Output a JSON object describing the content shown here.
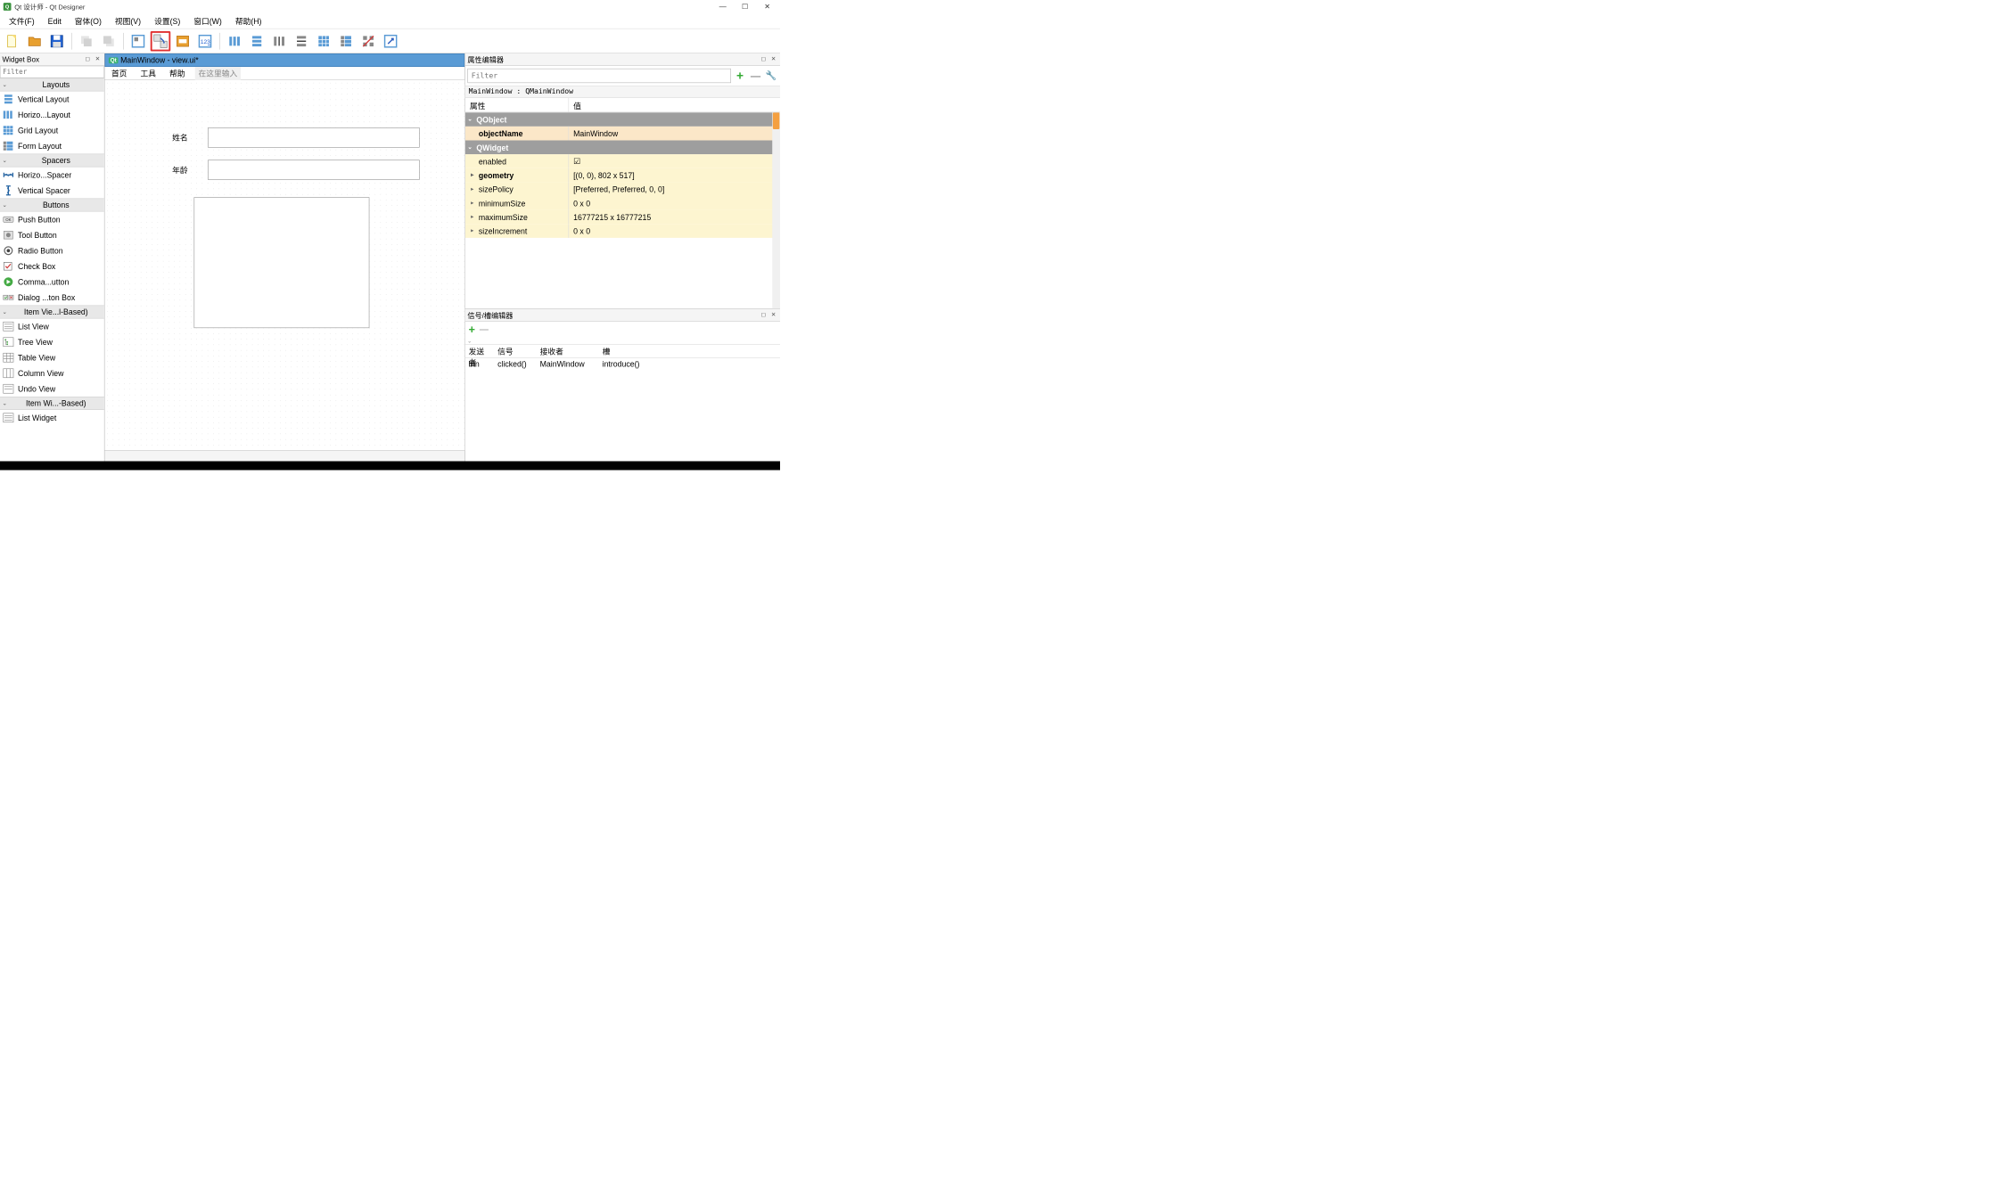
{
  "title": "Qt 设计师 - Qt Designer",
  "menubar": [
    "文件(F)",
    "Edit",
    "窗体(O)",
    "视图(V)",
    "设置(S)",
    "窗口(W)",
    "帮助(H)"
  ],
  "widgetbox": {
    "title": "Widget Box",
    "filter_placeholder": "Filter",
    "categories": [
      {
        "name": "Layouts",
        "items": [
          "Vertical Layout",
          "Horizo...Layout",
          "Grid Layout",
          "Form Layout"
        ]
      },
      {
        "name": "Spacers",
        "items": [
          "Horizo...Spacer",
          "Vertical Spacer"
        ]
      },
      {
        "name": "Buttons",
        "items": [
          "Push Button",
          "Tool Button",
          "Radio Button",
          "Check Box",
          "Comma...utton",
          "Dialog ...ton Box"
        ]
      },
      {
        "name": "Item Vie...l-Based)",
        "items": [
          "List View",
          "Tree View",
          "Table View",
          "Column View",
          "Undo View"
        ]
      },
      {
        "name": "Item Wi...-Based)",
        "items": [
          "List Widget"
        ]
      }
    ]
  },
  "form": {
    "title": "MainWindow - view.ui*",
    "menubar": [
      "首页",
      "工具",
      "帮助"
    ],
    "menubar_placeholder": "在这里输入",
    "labels": {
      "name": "姓名",
      "age": "年龄"
    }
  },
  "property_editor": {
    "title": "属性编辑器",
    "filter_placeholder": "Filter",
    "object_text": "MainWindow : QMainWindow",
    "col_prop": "属性",
    "col_val": "值",
    "groups": [
      {
        "name": "QObject",
        "rows": [
          {
            "prop": "objectName",
            "val": "MainWindow",
            "cls": "orange bold"
          }
        ]
      },
      {
        "name": "QWidget",
        "rows": [
          {
            "prop": "enabled",
            "val": "☑",
            "cls": "yellow"
          },
          {
            "prop": "geometry",
            "val": "[(0, 0), 802 x 517]",
            "cls": "yellow bold",
            "expandable": true
          },
          {
            "prop": "sizePolicy",
            "val": "[Preferred, Preferred, 0, 0]",
            "cls": "yellow",
            "expandable": true
          },
          {
            "prop": "minimumSize",
            "val": "0 x 0",
            "cls": "yellow",
            "expandable": true
          },
          {
            "prop": "maximumSize",
            "val": "16777215 x 16777215",
            "cls": "yellow",
            "expandable": true
          },
          {
            "prop": "sizeIncrement",
            "val": "0 x 0",
            "cls": "yellow",
            "expandable": true
          }
        ]
      }
    ]
  },
  "signal_editor": {
    "title": "信号/槽编辑器",
    "cols": [
      "发送者",
      "信号",
      "接收者",
      "槽"
    ],
    "rows": [
      {
        "sender": "btn",
        "signal": "clicked()",
        "receiver": "MainWindow",
        "slot": "introduce()"
      }
    ]
  }
}
